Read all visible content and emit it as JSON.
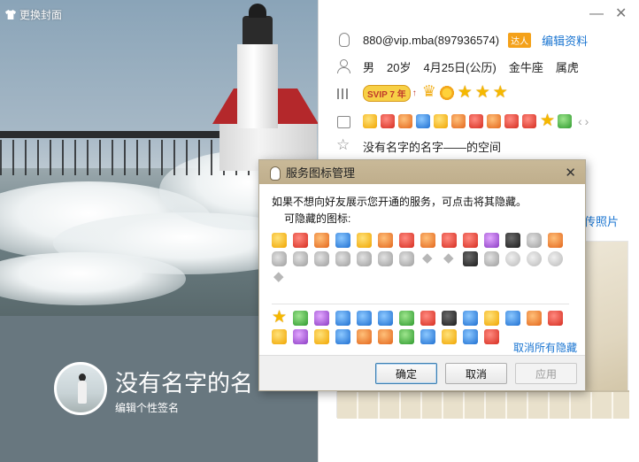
{
  "cover": {
    "change_cover_label": "更换封面",
    "nickname": "没有名字的名",
    "sign_label": "编辑个性签名"
  },
  "window": {
    "minimize": "—",
    "close": "✕"
  },
  "profile": {
    "account": "880@vip.mba(897936574)",
    "daren_badge": "达人",
    "edit_label": "编辑资料",
    "gender": "男",
    "age": "20岁",
    "birthday": "4月25日(公历)",
    "zodiac": "金牛座",
    "chinese_zodiac": "属虎",
    "vip_badge": "SVIP 7",
    "vip_year": "年",
    "signature": "没有名字的名字——的空间",
    "upload_photo": "传照片"
  },
  "dialog": {
    "title": "服务图标管理",
    "close": "✕",
    "hint": "如果不想向好友展示您开通的服务，可点击将其隐藏。",
    "hidden_label": "可隐藏的图标:",
    "cancel_all_hidden": "取消所有隐藏",
    "ok": "确定",
    "cancel": "取消",
    "apply": "应用"
  },
  "colors": {
    "link": "#1a75d1",
    "dialog_title_bg": "#c9b998",
    "cover_bottom": "#68777f"
  }
}
